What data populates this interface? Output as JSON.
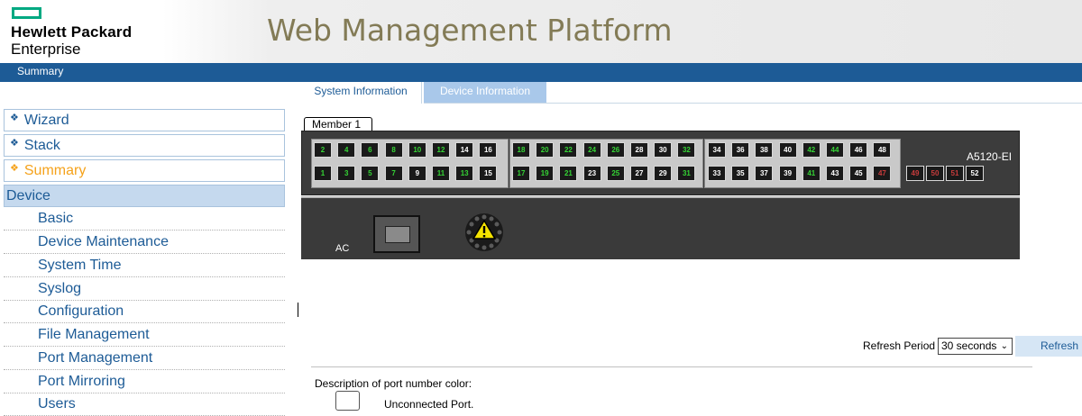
{
  "header": {
    "brand_line1": "Hewlett Packard",
    "brand_line2": "Enterprise",
    "title": "Web Management Platform",
    "brand_color": "#01a982"
  },
  "bluebar": {
    "label": "Summary",
    "color": "#1d5b96"
  },
  "nav": {
    "items": [
      {
        "label": "Wizard"
      },
      {
        "label": "Stack"
      },
      {
        "label": "Summary"
      },
      {
        "label": "Device"
      }
    ],
    "sub_items": [
      "Basic",
      "Device Maintenance",
      "System Time",
      "Syslog",
      "Configuration",
      "File Management",
      "Port Management",
      "Port Mirroring",
      "Users"
    ]
  },
  "tabs": {
    "system_information": "System Information",
    "device_information": "Device Information"
  },
  "device": {
    "member_tab": "Member 1",
    "model": "A5120-EI",
    "ac_label": "AC",
    "ports_top": [
      {
        "n": "2",
        "c": "green"
      },
      {
        "n": "4",
        "c": "green"
      },
      {
        "n": "6",
        "c": "green"
      },
      {
        "n": "8",
        "c": "green"
      },
      {
        "n": "10",
        "c": "green"
      },
      {
        "n": "12",
        "c": "green"
      },
      {
        "n": "14",
        "c": "white"
      },
      {
        "n": "16",
        "c": "white"
      },
      {
        "n": "18",
        "c": "green"
      },
      {
        "n": "20",
        "c": "green"
      },
      {
        "n": "22",
        "c": "green"
      },
      {
        "n": "24",
        "c": "green"
      },
      {
        "n": "26",
        "c": "green"
      },
      {
        "n": "28",
        "c": "white"
      },
      {
        "n": "30",
        "c": "white"
      },
      {
        "n": "32",
        "c": "green"
      },
      {
        "n": "34",
        "c": "white"
      },
      {
        "n": "36",
        "c": "white"
      },
      {
        "n": "38",
        "c": "white"
      },
      {
        "n": "40",
        "c": "white"
      },
      {
        "n": "42",
        "c": "green"
      },
      {
        "n": "44",
        "c": "green"
      },
      {
        "n": "46",
        "c": "white"
      },
      {
        "n": "48",
        "c": "white"
      }
    ],
    "ports_bottom": [
      {
        "n": "1",
        "c": "green"
      },
      {
        "n": "3",
        "c": "green"
      },
      {
        "n": "5",
        "c": "green"
      },
      {
        "n": "7",
        "c": "green"
      },
      {
        "n": "9",
        "c": "white"
      },
      {
        "n": "11",
        "c": "green"
      },
      {
        "n": "13",
        "c": "green"
      },
      {
        "n": "15",
        "c": "white"
      },
      {
        "n": "17",
        "c": "green"
      },
      {
        "n": "19",
        "c": "green"
      },
      {
        "n": "21",
        "c": "green"
      },
      {
        "n": "23",
        "c": "white"
      },
      {
        "n": "25",
        "c": "green"
      },
      {
        "n": "27",
        "c": "white"
      },
      {
        "n": "29",
        "c": "white"
      },
      {
        "n": "31",
        "c": "green"
      },
      {
        "n": "33",
        "c": "white"
      },
      {
        "n": "35",
        "c": "white"
      },
      {
        "n": "37",
        "c": "white"
      },
      {
        "n": "39",
        "c": "white"
      },
      {
        "n": "41",
        "c": "green"
      },
      {
        "n": "43",
        "c": "white"
      },
      {
        "n": "45",
        "c": "white"
      },
      {
        "n": "47",
        "c": "red"
      }
    ],
    "sfp_ports": [
      {
        "n": "49",
        "c": "red"
      },
      {
        "n": "50",
        "c": "red"
      },
      {
        "n": "51",
        "c": "red"
      },
      {
        "n": "52",
        "c": "white"
      }
    ]
  },
  "refresh": {
    "label": "Refresh Period",
    "selected": "30 seconds",
    "button": "Refresh"
  },
  "legend": {
    "title": "Description of port number color:",
    "unconnected": "Unconnected Port."
  }
}
